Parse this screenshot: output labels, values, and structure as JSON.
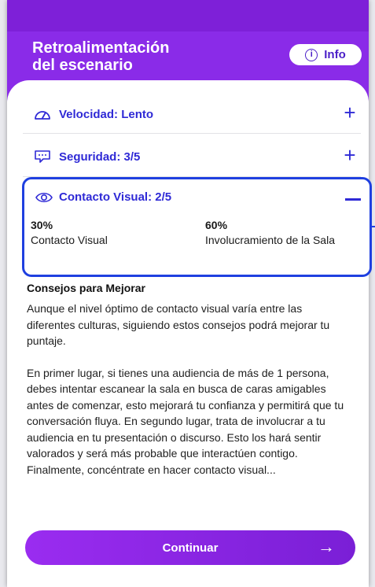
{
  "header": {
    "title_line1": "Retroalimentación",
    "title_line2": "del escenario",
    "info_label": "Info",
    "info_icon": "info-circle-icon"
  },
  "accordion": {
    "speed": {
      "label": "Velocidad: Lento",
      "icon": "gauge-icon",
      "expanded": false
    },
    "security": {
      "label": "Seguridad: 3/5",
      "icon": "message-dots-icon",
      "expanded": false
    },
    "contact": {
      "label": "Contacto Visual:  2/5",
      "icon": "eye-icon",
      "expanded": true,
      "stats": [
        {
          "value": "30%",
          "label": "Contacto Visual"
        },
        {
          "value": "60%",
          "label": "Involucramiento de la Sala"
        }
      ]
    }
  },
  "tips": {
    "title": "Consejos para Mejorar",
    "paragraph1": "Aunque el nivel óptimo de contacto visual varía entre las diferentes culturas, siguiendo estos consejos podrá mejorar tu puntaje.",
    "paragraph2": "En primer lugar, si tienes una audiencia de más de 1 persona, debes intentar escanear la sala en busca de caras amigables antes de comenzar, esto mejorará tu confianza y permitirá que tu conversación fluya. En segundo lugar, trata de involucrar a tu audiencia en tu presentación o discurso. Esto los hará sentir valorados y será más probable que interactúen contigo. Finalmente, concéntrate en hacer contacto visual..."
  },
  "footer": {
    "continue_label": "Continuar",
    "arrow": "→"
  },
  "colors": {
    "header_purple": "#8a2be8",
    "accent_blue": "#2f2ad6",
    "highlight_border": "#1f40e0"
  }
}
